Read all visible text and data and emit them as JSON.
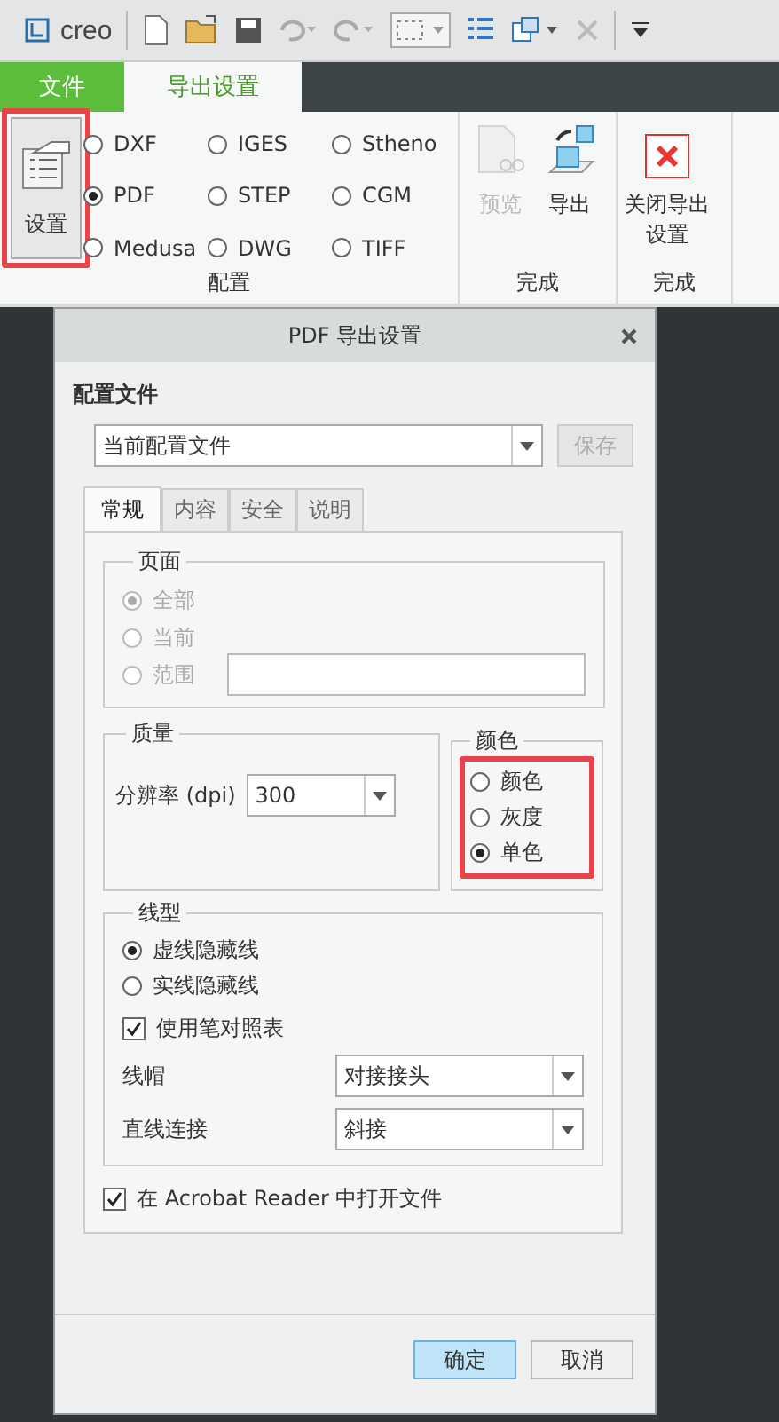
{
  "app": {
    "logo": "creo"
  },
  "ribbon_tabs": [
    {
      "label": "文件",
      "kind": "file",
      "selected": false
    },
    {
      "label": "导出设置",
      "kind": "tab",
      "selected": true
    }
  ],
  "ribbon": {
    "settings_button": {
      "label": "设置",
      "highlighted": true
    },
    "formats": [
      {
        "label": "DXF",
        "selected": false
      },
      {
        "label": "IGES",
        "selected": false
      },
      {
        "label": "Stheno",
        "selected": false
      },
      {
        "label": "PDF",
        "selected": true
      },
      {
        "label": "STEP",
        "selected": false
      },
      {
        "label": "CGM",
        "selected": false
      },
      {
        "label": "Medusa",
        "selected": false
      },
      {
        "label": "DWG",
        "selected": false
      },
      {
        "label": "TIFF",
        "selected": false
      }
    ],
    "config_group": "配置",
    "preview_button": {
      "label": "预览",
      "disabled": true
    },
    "export_button": {
      "label": "导出",
      "disabled": false
    },
    "finish_group": "完成",
    "close_button": {
      "label": "关闭导出设置"
    },
    "close_group": "完成"
  },
  "dialog": {
    "title": "PDF 导出设置",
    "profile_label": "配置文件",
    "profile_select": {
      "value": "当前配置文件"
    },
    "save_button": {
      "label": "保存",
      "disabled": true
    },
    "tabs": [
      {
        "label": "常规",
        "selected": true
      },
      {
        "label": "内容",
        "selected": false
      },
      {
        "label": "安全",
        "selected": false
      },
      {
        "label": "说明",
        "selected": false
      }
    ],
    "page": {
      "title": "页面",
      "options": [
        {
          "label": "全部",
          "selected": true,
          "disabled": true
        },
        {
          "label": "当前",
          "selected": false,
          "disabled": true
        },
        {
          "label": "范围",
          "selected": false,
          "disabled": true
        }
      ]
    },
    "quality": {
      "title": "质量",
      "resolution_label": "分辨率 (dpi)",
      "resolution_value": "300"
    },
    "color": {
      "title": "颜色",
      "highlighted": true,
      "options": [
        {
          "label": "颜色",
          "selected": false
        },
        {
          "label": "灰度",
          "selected": false
        },
        {
          "label": "单色",
          "selected": true
        }
      ]
    },
    "line": {
      "title": "线型",
      "options": [
        {
          "label": "虚线隐藏线",
          "selected": true
        },
        {
          "label": "实线隐藏线",
          "selected": false
        }
      ],
      "pen_table": {
        "label": "使用笔对照表",
        "checked": true
      },
      "cap": {
        "label": "线帽",
        "value": "对接接头"
      },
      "join": {
        "label": "直线连接",
        "value": "斜接"
      }
    },
    "open_reader": {
      "label": "在 Acrobat Reader 中打开文件",
      "checked": true
    },
    "buttons": [
      {
        "label": "确定",
        "selected": true
      },
      {
        "label": "取消",
        "selected": false
      }
    ]
  }
}
